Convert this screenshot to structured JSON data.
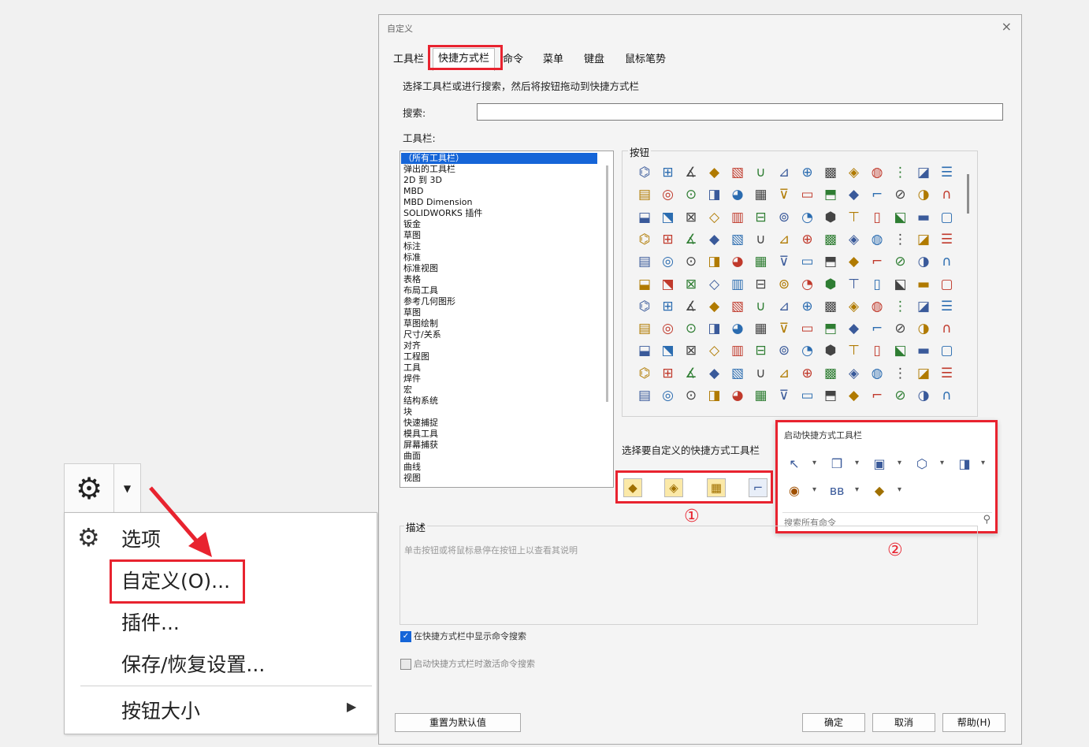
{
  "context_menu": {
    "items": [
      {
        "label": "选项",
        "icon": "gear-icon"
      },
      {
        "label": "自定义(O)..."
      },
      {
        "label": "插件..."
      },
      {
        "label": "保存/恢复设置..."
      },
      {
        "label": "按钮大小"
      }
    ]
  },
  "dialog": {
    "title": "自定义",
    "close": "×",
    "tabs": [
      "工具栏",
      "快捷方式栏",
      "命令",
      "菜单",
      "键盘",
      "鼠标笔势"
    ],
    "instruction": "选择工具栏或进行搜索，然后将按钮拖动到快捷方式栏",
    "search_label": "搜索:",
    "toolbars_label": "工具栏:",
    "toolbar_items": [
      "（所有工具栏）",
      "弹出的工具栏",
      "2D 到 3D",
      "MBD",
      "MBD Dimension",
      "SOLIDWORKS 插件",
      "钣金",
      "草图",
      "标注",
      "标准",
      "标准视图",
      "表格",
      "布局工具",
      "参考几何图形",
      "草图",
      "草图绘制",
      "尺寸/关系",
      "对齐",
      "工程图",
      "工具",
      "焊件",
      "宏",
      "结构系统",
      "块",
      "快速捕捉",
      "模具工具",
      "屏幕捕获",
      "曲面",
      "曲线",
      "视图"
    ],
    "buttons_label": "按钮",
    "select_label": "选择要自定义的快捷方式工具栏",
    "circle1": "①",
    "circle2": "②",
    "popup": {
      "title": "启动快捷方式工具栏",
      "search_placeholder": "搜索所有命令"
    },
    "desc_label": "描述",
    "desc_text": "单击按钮或将鼠标悬停在按钮上以查看其说明",
    "checkbox1": "在快捷方式栏中显示命令搜索",
    "checkbox2": "启动快捷方式栏时激活命令搜索",
    "reset_button": "重置为默认值",
    "ok_button": "确定",
    "cancel_button": "取消",
    "help_button": "帮助(H)"
  }
}
